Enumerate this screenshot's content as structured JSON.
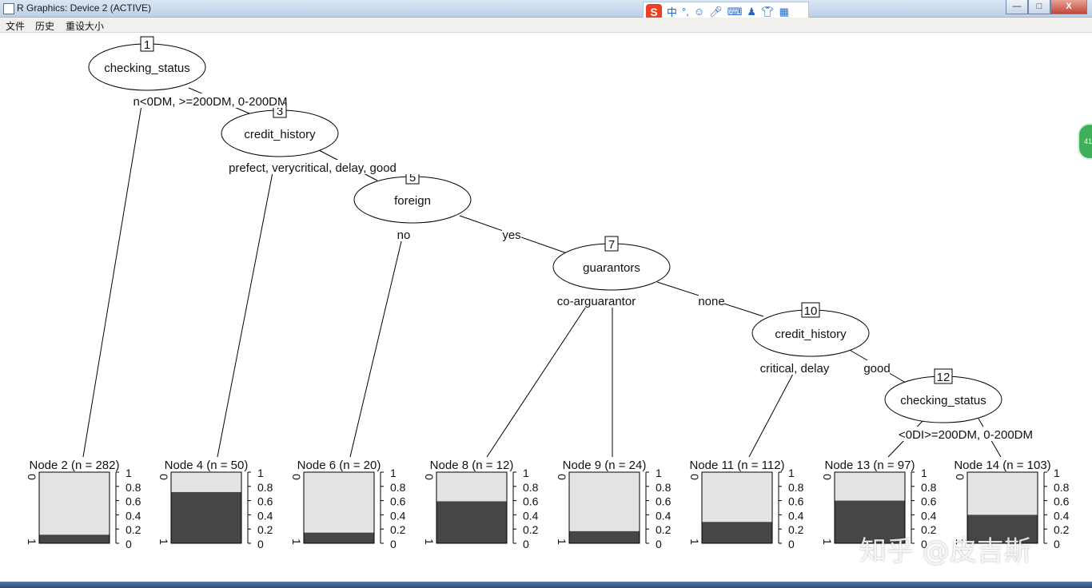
{
  "window": {
    "title": "R Graphics: Device 2 (ACTIVE)",
    "buttons": {
      "minimize": "—",
      "maximize": "□",
      "close": "X"
    }
  },
  "ime_toolbar": {
    "logo": "S",
    "mode": "中",
    "punct": "°,"
  },
  "menu": {
    "items": [
      "文件",
      "历史",
      "重设大小"
    ]
  },
  "side_badge": "41",
  "watermark": "知乎 @皮吉斯",
  "tree": {
    "inner_nodes": [
      {
        "id": "1",
        "variable": "checking_status"
      },
      {
        "id": "3",
        "variable": "credit_history"
      },
      {
        "id": "5",
        "variable": "foreign"
      },
      {
        "id": "7",
        "variable": "guarantors"
      },
      {
        "id": "10",
        "variable": "credit_history"
      },
      {
        "id": "12",
        "variable": "checking_status"
      }
    ],
    "edge_labels": [
      "n<0DM, >=200DM, 0-200DM",
      "prefect, verycritical, delay, good",
      "no",
      "yes",
      "co-arguarantor",
      "none",
      "critical, delay",
      "good",
      "<0DI>=200DM, 0-200DM"
    ],
    "terminal_nodes": [
      {
        "label": "Node 2 (n = 282)",
        "fraction_1": 0.12
      },
      {
        "label": "Node 4 (n = 50)",
        "fraction_1": 0.72
      },
      {
        "label": "Node 6 (n = 20)",
        "fraction_1": 0.15
      },
      {
        "label": "Node 8 (n = 12)",
        "fraction_1": 0.59
      },
      {
        "label": "Node 9 (n = 24)",
        "fraction_1": 0.17
      },
      {
        "label": "Node 11 (n = 112)",
        "fraction_1": 0.3
      },
      {
        "label": "Node 13 (n = 97)",
        "fraction_1": 0.6
      },
      {
        "label": "Node 14 (n = 103)",
        "fraction_1": 0.4
      }
    ],
    "axis_ticks": [
      "1",
      "0.8",
      "0.6",
      "0.4",
      "0.2",
      "0"
    ],
    "class_labels": [
      "0",
      "1"
    ],
    "colors": {
      "class_1": "#464646",
      "class_0": "#e4e4e4"
    }
  }
}
